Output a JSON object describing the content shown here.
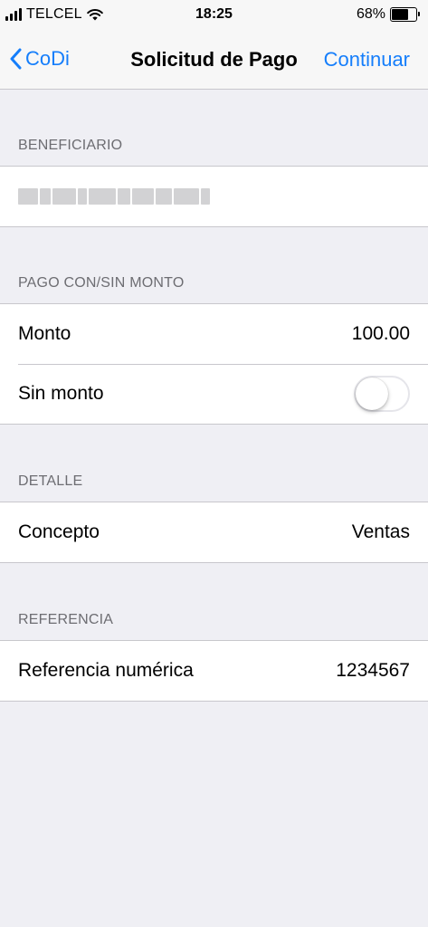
{
  "status_bar": {
    "carrier": "TELCEL",
    "time": "18:25",
    "battery": "68%",
    "battery_level": 0.68
  },
  "nav": {
    "back_label": "CoDi",
    "title": "Solicitud de Pago",
    "action_label": "Continuar",
    "accent_color": "#157efb"
  },
  "sections": {
    "beneficiario": {
      "header": "BENEFICIARIO",
      "name_blurred": true
    },
    "pago": {
      "header": "PAGO CON/SIN MONTO",
      "monto_label": "Monto",
      "monto_value": "100.00",
      "sin_monto_label": "Sin monto",
      "sin_monto_on": false
    },
    "detalle": {
      "header": "DETALLE",
      "concepto_label": "Concepto",
      "concepto_value": "Ventas"
    },
    "referencia": {
      "header": "REFERENCIA",
      "referencia_label": "Referencia numérica",
      "referencia_value": "1234567"
    }
  }
}
